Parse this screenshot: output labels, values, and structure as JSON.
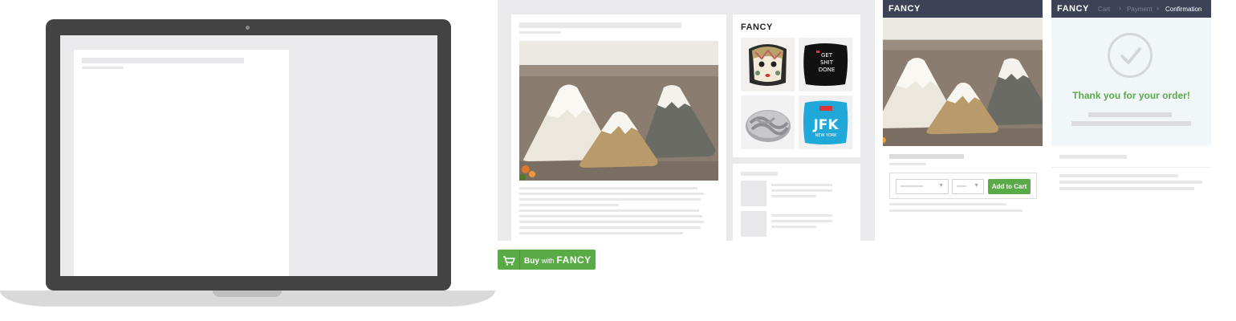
{
  "brand": {
    "name": "FANCY",
    "accent_color": "#5aab47",
    "header_color": "#3d4356"
  },
  "widget": {
    "title": "FANCY",
    "thumbnails": [
      {
        "icon": "geisha-pillow-icon"
      },
      {
        "icon": "get-shit-done-pillow-icon",
        "text": "GET SHIT DONE"
      },
      {
        "icon": "knot-pillow-icon"
      },
      {
        "icon": "jfk-pillow-icon",
        "text": "JFK",
        "subtext": "NEW YORK"
      }
    ]
  },
  "buy_button": {
    "prefix": "Buy",
    "connector": "with",
    "brand": "FANCY",
    "icon": "cart-icon"
  },
  "product_card": {
    "header": "FANCY",
    "add_to_cart_label": "Add to Cart"
  },
  "checkout": {
    "logo": "FANCY",
    "steps": [
      "Cart",
      "Payment",
      "Confirmation"
    ],
    "active_step": "Confirmation",
    "message": "Thank you for your order!",
    "icon": "checkmark-icon"
  }
}
